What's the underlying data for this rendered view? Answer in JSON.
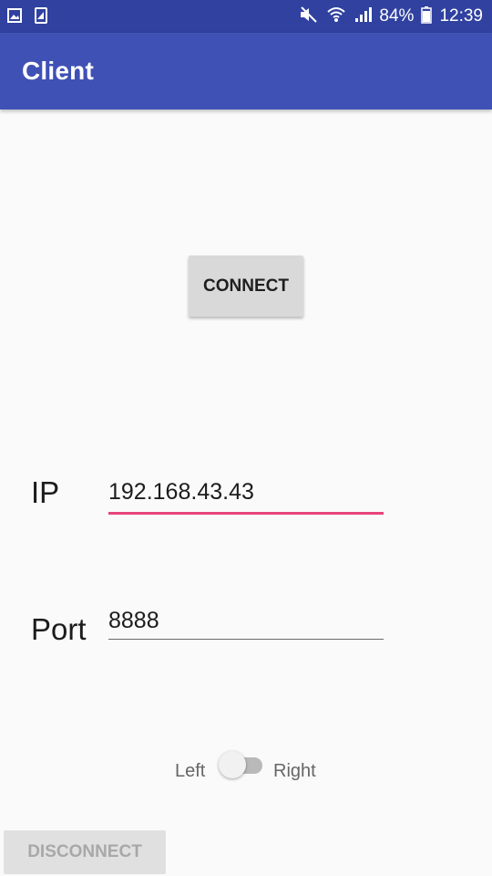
{
  "status_bar": {
    "battery": "84%",
    "time": "12:39",
    "left_icons": [
      "image-icon",
      "screenshot-icon"
    ],
    "right_icons": [
      "mute-icon",
      "wifi-icon",
      "signal-icon",
      "battery-icon"
    ]
  },
  "app_bar": {
    "title": "Client"
  },
  "actions": {
    "connect_label": "CONNECT",
    "disconnect_label": "DISCONNECT",
    "disconnect_enabled": false
  },
  "form": {
    "ip_label": "IP",
    "ip_value": "192.168.43.43",
    "port_label": "Port",
    "port_value": "8888"
  },
  "direction_switch": {
    "left_label": "Left",
    "right_label": "Right",
    "state": "Left"
  },
  "colors": {
    "status_bar": "#3041a0",
    "app_bar": "#3f51b5",
    "accent": "#e8437a",
    "background": "#fafafa"
  }
}
